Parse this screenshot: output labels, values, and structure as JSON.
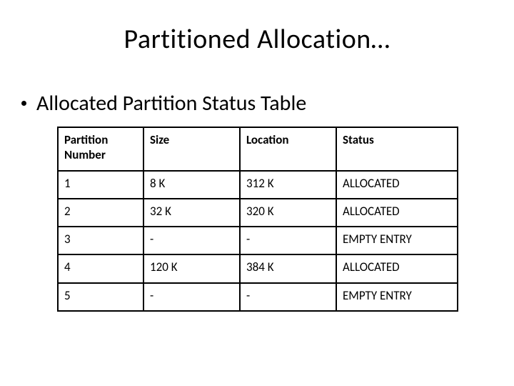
{
  "title": "Partitioned Allocation…",
  "bullet": "Allocated Partition Status Table",
  "chart_data": {
    "type": "table",
    "columns": [
      "Partition Number",
      "Size",
      "Location",
      "Status"
    ],
    "rows": [
      {
        "partition_number": "1",
        "size": "8 K",
        "location": "312 K",
        "status": "ALLOCATED"
      },
      {
        "partition_number": "2",
        "size": "32 K",
        "location": "320 K",
        "status": "ALLOCATED"
      },
      {
        "partition_number": "3",
        "size": "-",
        "location": "-",
        "status": "EMPTY ENTRY"
      },
      {
        "partition_number": "4",
        "size": "120 K",
        "location": "384 K",
        "status": "ALLOCATED"
      },
      {
        "partition_number": "5",
        "size": "-",
        "location": "-",
        "status": "EMPTY ENTRY"
      }
    ]
  }
}
